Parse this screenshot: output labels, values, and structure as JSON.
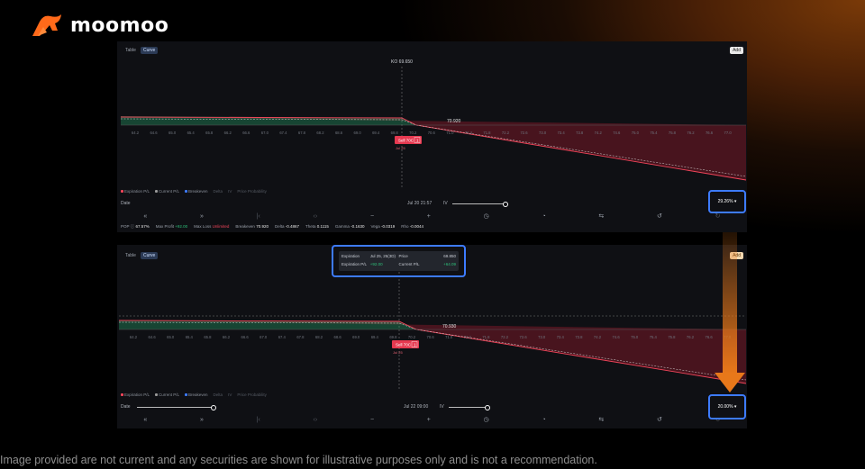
{
  "brand": {
    "name": "moomoo"
  },
  "colors": {
    "accent": "#3d7bff",
    "profit": "#2ec07a",
    "loss": "#f2455a",
    "orange": "#e8781a"
  },
  "x_ticks": [
    "64.2",
    "64.6",
    "65.0",
    "65.4",
    "65.8",
    "66.2",
    "66.6",
    "67.0",
    "67.4",
    "67.8",
    "68.2",
    "68.6",
    "69.0",
    "69.4",
    "69.8",
    "70.2",
    "70.6",
    "71.0",
    "71.4",
    "71.8",
    "72.2",
    "72.6",
    "73.0",
    "73.4",
    "73.8",
    "74.2",
    "74.6",
    "75.0",
    "75.4",
    "75.8",
    "76.2",
    "76.6",
    "77.0"
  ],
  "panel1": {
    "tabs": [
      "Table",
      "Curve"
    ],
    "add_label": "Add",
    "price_label": "KO 69.650",
    "breakeven_value": "70.920",
    "sell_tag": "Sell 70C",
    "sell_count": "1",
    "expiry_tag": "Jul 25",
    "legend": [
      "Expiration P/L",
      "Current P/L",
      "Breakeven",
      "Delta",
      "IV",
      "Price Probability"
    ],
    "date_label": "Date",
    "date_value": "Jul 20 21:57",
    "iv_label": "IV",
    "iv_value": "29.26%",
    "toolbar": [
      "«",
      "»",
      "|‹",
      "‹›",
      "−",
      "+",
      "◷",
      "◔",
      "⇆",
      "↺",
      "↻"
    ],
    "stats": {
      "pop_label": "POP",
      "pop_value": "67.57%",
      "max_profit_label": "Max Profit",
      "max_profit_value": "+92.00",
      "max_loss_label": "Max Loss",
      "max_loss_value": "Unlimited",
      "breakeven_label": "Breakeven",
      "breakeven_value": "70.920",
      "delta_label": "Delta",
      "delta_value": "-0.4867",
      "theta_label": "Theta",
      "theta_value": "0.1115",
      "gamma_label": "Gamma",
      "gamma_value": "-0.1630",
      "vega_label": "Vega",
      "vega_value": "-0.0319",
      "rho_label": "Rho",
      "rho_value": "-0.0044"
    }
  },
  "panel2": {
    "tabs": [
      "Table",
      "Curve"
    ],
    "add_label": "Add",
    "breakeven_value": "70.930",
    "sell_tag": "Sell 70C",
    "sell_count": "1",
    "expiry_tag": "Jul 25",
    "legend": [
      "Expiration P/L",
      "Current P/L",
      "Breakeven",
      "Delta",
      "IV",
      "Price Probability"
    ],
    "date_label": "Date",
    "date_value": "Jul 22 09:00",
    "iv_label": "IV",
    "iv_value": "20.00%",
    "toolbar": [
      "«",
      "»",
      "|‹",
      "‹›",
      "−",
      "+",
      "◷",
      "◔",
      "⇆",
      "↺",
      "↻"
    ],
    "tooltip": {
      "expiration_label": "Expiration",
      "expiration_value": "Jul 25, 25(3D)",
      "price_label": "Price",
      "price_value": "69.850",
      "exp_pl_label": "Expiration P/L",
      "exp_pl_value": "+92.00",
      "cur_pl_label": "Current P/L",
      "cur_pl_value": "+64.09"
    }
  },
  "footer": {
    "disclaimer": "Image provided are not current and any securities are shown for illustrative purposes only and is not a recommendation."
  }
}
